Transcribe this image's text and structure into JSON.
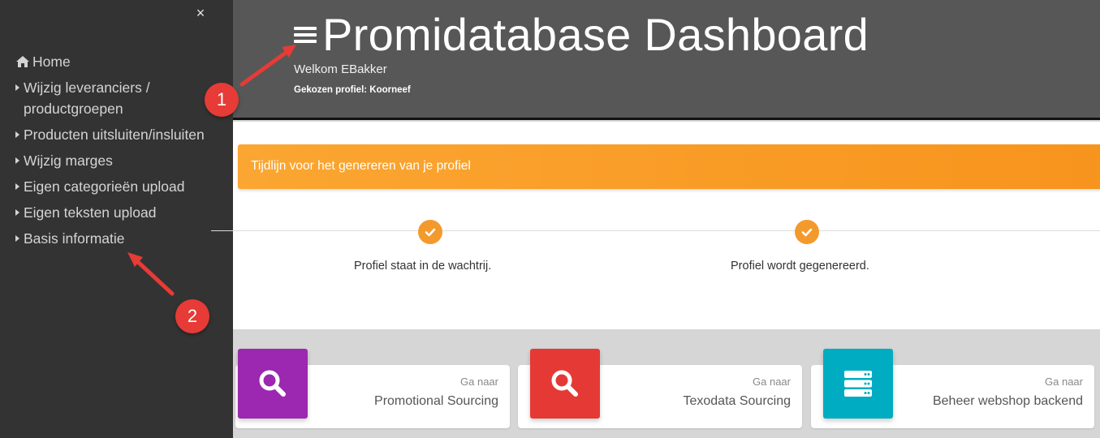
{
  "sidebar": {
    "close_label": "×",
    "items": [
      {
        "label": "Home",
        "icon": "home-icon"
      },
      {
        "label": "Wijzig leveranciers / productgroepen",
        "icon": "caret-right-icon"
      },
      {
        "label": "Producten uitsluiten/insluiten",
        "icon": "caret-right-icon"
      },
      {
        "label": "Wijzig marges",
        "icon": "caret-right-icon"
      },
      {
        "label": "Eigen categorieën upload",
        "icon": "caret-right-icon"
      },
      {
        "label": "Eigen teksten upload",
        "icon": "caret-right-icon"
      },
      {
        "label": "Basis informatie",
        "icon": "caret-right-icon"
      }
    ]
  },
  "header": {
    "title": "Promidatabase Dashboard",
    "welcome": "Welkom EBakker",
    "profile": "Gekozen profiel: Koorneef",
    "menu_icon": "hamburger-icon"
  },
  "timeline": {
    "banner": "Tijdlijn voor het genereren van je profiel",
    "steps": [
      {
        "label": "Profiel staat in de wachtrij.",
        "status": "done"
      },
      {
        "label": "Profiel wordt gegenereerd.",
        "status": "done"
      }
    ],
    "accent_color": "#f7941d"
  },
  "cards": [
    {
      "goto": "Ga naar",
      "title": "Promotional Sourcing",
      "icon": "search-icon",
      "color": "#9c27b0"
    },
    {
      "goto": "Ga naar",
      "title": "Texodata Sourcing",
      "icon": "search-icon",
      "color": "#e53935"
    },
    {
      "goto": "Ga naar",
      "title": "Beheer webshop backend",
      "icon": "server-icon",
      "color": "#00acc1"
    }
  ],
  "annotations": [
    "1",
    "2"
  ]
}
